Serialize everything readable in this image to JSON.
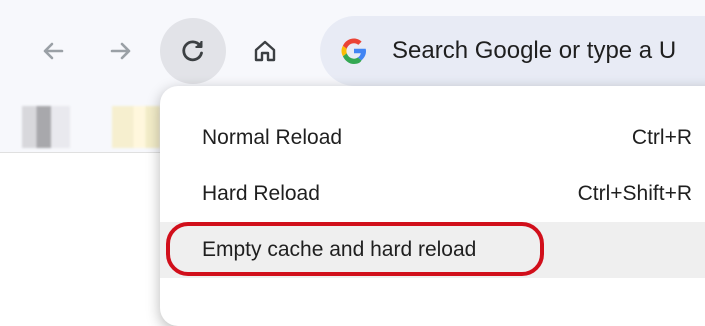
{
  "omnibox": {
    "text": "Search Google or type a U"
  },
  "reload_menu": {
    "items": [
      {
        "label": "Normal Reload",
        "shortcut": "Ctrl+R"
      },
      {
        "label": "Hard Reload",
        "shortcut": "Ctrl+Shift+R"
      },
      {
        "label": "Empty cache and hard reload",
        "shortcut": ""
      }
    ]
  },
  "colors": {
    "toolbar_bg": "#f7f8fc",
    "omnibox_bg": "#e8ebf5",
    "highlight": "#d10f1b",
    "hover_row": "#efefef"
  },
  "icons": [
    "back-arrow-icon",
    "forward-arrow-icon",
    "reload-icon",
    "home-icon",
    "google-g-icon"
  ]
}
